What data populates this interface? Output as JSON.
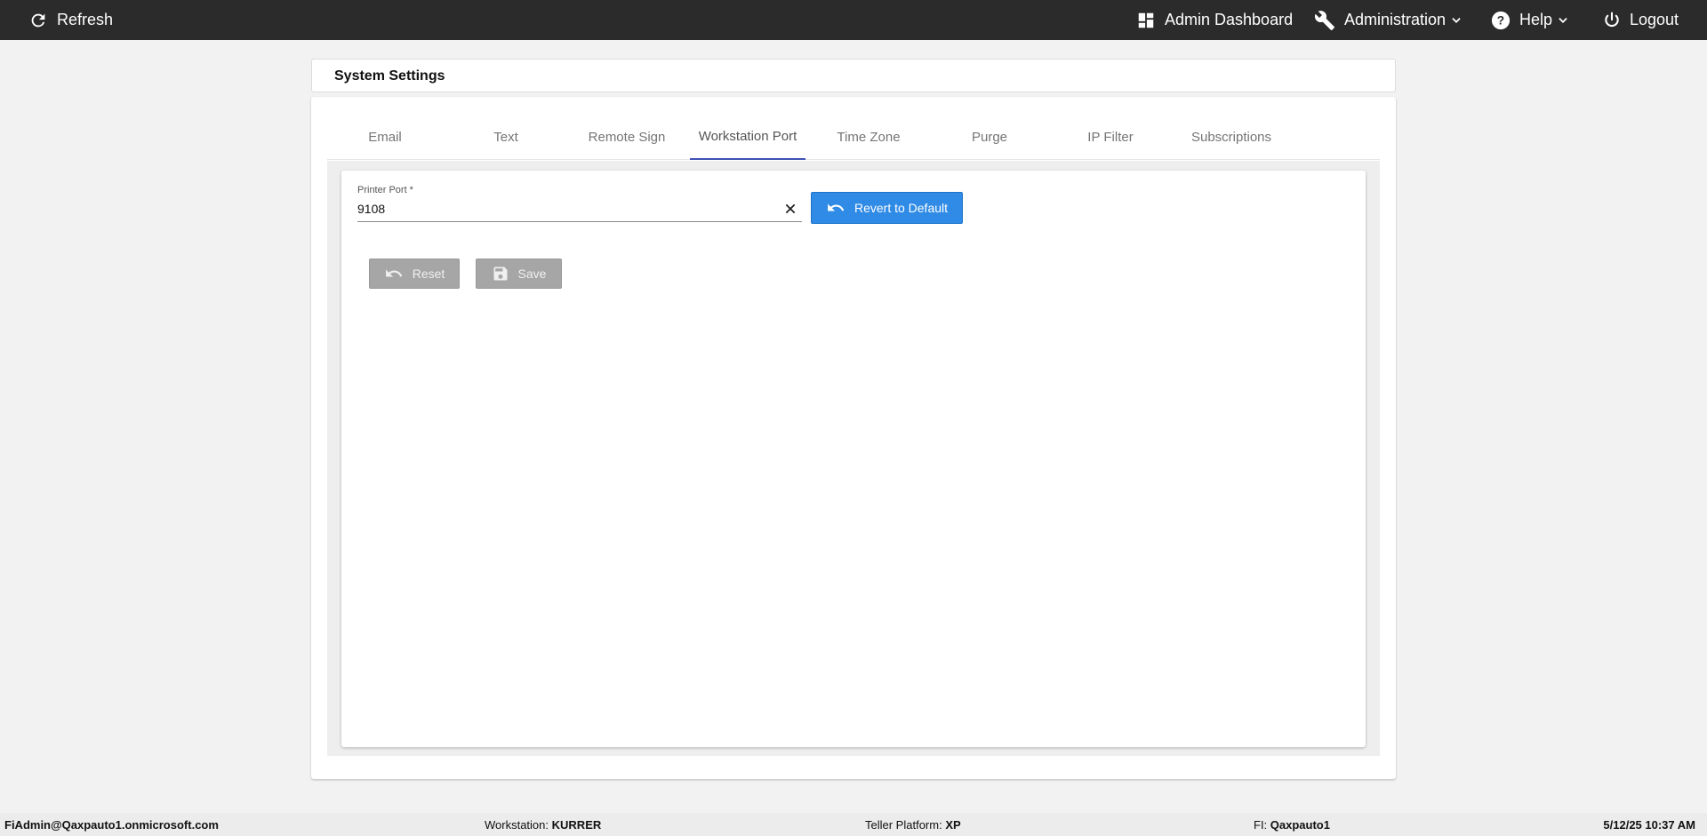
{
  "topbar": {
    "refresh_label": "Refresh",
    "admin_dashboard_label": "Admin Dashboard",
    "administration_label": "Administration",
    "help_label": "Help",
    "logout_label": "Logout"
  },
  "page": {
    "title": "System Settings"
  },
  "tabs": [
    {
      "label": "Email"
    },
    {
      "label": "Text"
    },
    {
      "label": "Remote Sign"
    },
    {
      "label": "Workstation Port",
      "active": true
    },
    {
      "label": "Time Zone"
    },
    {
      "label": "Purge"
    },
    {
      "label": "IP Filter"
    },
    {
      "label": "Subscriptions"
    }
  ],
  "form": {
    "printer_port_label": "Printer Port *",
    "printer_port_value": "9108",
    "revert_label": "Revert to Default",
    "reset_label": "Reset",
    "save_label": "Save"
  },
  "status": {
    "user": "FiAdmin@Qaxpauto1.onmicrosoft.com",
    "workstation_label": "Workstation:",
    "workstation_value": "KURRER",
    "teller_label": "Teller Platform:",
    "teller_value": "XP",
    "fi_label": "FI:",
    "fi_value": "Qaxpauto1",
    "datetime": "5/12/25 10:37 AM"
  },
  "colors": {
    "topbar_bg": "#2b2b2b",
    "active_tab_indicator": "#3f51b5",
    "primary_button": "#2f8be6",
    "disabled_button": "#a6a6a6"
  }
}
